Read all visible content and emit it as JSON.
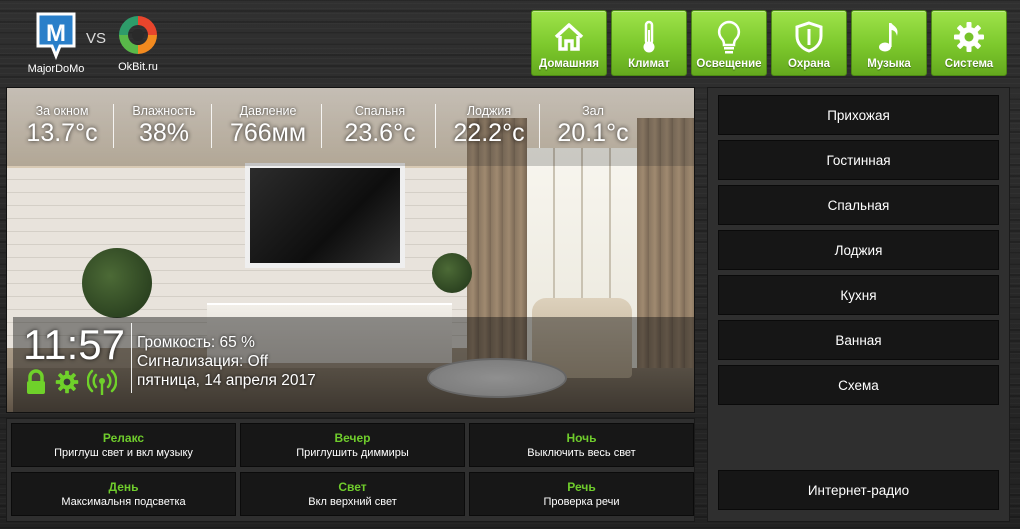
{
  "header": {
    "majordomo_caption": "MajorDoMo",
    "vs": "VS",
    "okbit_caption": "OkBit.ru"
  },
  "nav": [
    {
      "label": "Домашняя",
      "icon": "home-icon"
    },
    {
      "label": "Климат",
      "icon": "thermometer-icon"
    },
    {
      "label": "Освещение",
      "icon": "lightbulb-icon"
    },
    {
      "label": "Охрана",
      "icon": "shield-icon"
    },
    {
      "label": "Музыка",
      "icon": "music-note-icon"
    },
    {
      "label": "Система",
      "icon": "gear-icon"
    }
  ],
  "sensors": [
    {
      "label": "За окном",
      "value": "13.7°c"
    },
    {
      "label": "Влажность",
      "value": "38%"
    },
    {
      "label": "Давление",
      "value": "766мм"
    },
    {
      "label": "Спальня",
      "value": "23.6°c"
    },
    {
      "label": "Лоджия",
      "value": "22.2°c"
    },
    {
      "label": "Зал",
      "value": "20.1°c"
    }
  ],
  "status": {
    "time": "11:57",
    "volume": "Громкость: 65 %",
    "alarm": "Сигнализация: Off",
    "date": "пятница, 14 апреля 2017",
    "icons": [
      "lock-icon",
      "gear-icon",
      "wifi-antenna-icon"
    ]
  },
  "scenes": [
    {
      "title": "Релакс",
      "desc": "Приглуш свет и вкл музыку"
    },
    {
      "title": "Вечер",
      "desc": "Приглушить диммиры"
    },
    {
      "title": "Ночь",
      "desc": "Выключить весь свет"
    },
    {
      "title": "День",
      "desc": "Максимальня подсветка"
    },
    {
      "title": "Свет",
      "desc": "Вкл верхний свет"
    },
    {
      "title": "Речь",
      "desc": "Проверка речи"
    }
  ],
  "rooms": [
    "Прихожая",
    "Гостинная",
    "Спальная",
    "Лоджия",
    "Кухня",
    "Ванная",
    "Схема"
  ],
  "radio": "Интернет-радио",
  "colors": {
    "accent_green": "#7cc82c",
    "scene_title_green": "#6fcc2c",
    "majordomo_blue": "#2a7fc9",
    "panel_dark": "#161616"
  }
}
